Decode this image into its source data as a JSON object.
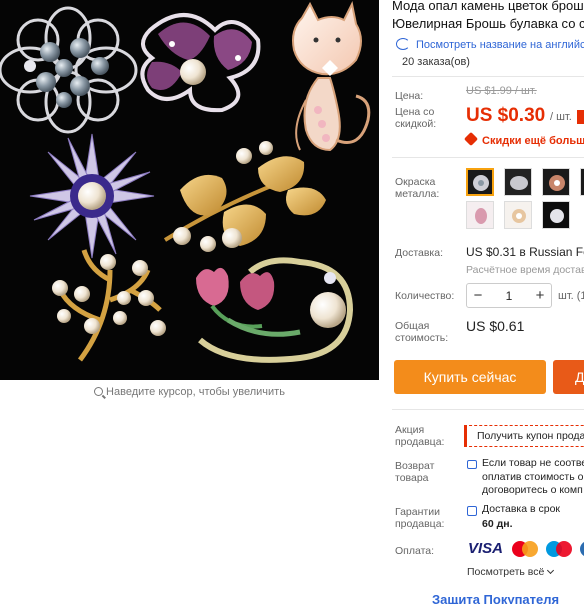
{
  "product": {
    "title_line1": "Мода опал камень цветок брош",
    "title_line2": "Ювелирная Брошь булавка со с",
    "translate_link": "Посмотреть название на английс",
    "orders": "20 заказа(ов)"
  },
  "image": {
    "zoom_hint": "Наведите курсор, чтобы увеличить"
  },
  "price": {
    "label": "Цена:",
    "old_value": "US $1.99 / шт.",
    "discount_label": "Цена со скидкой:",
    "value": "US $0.30",
    "per_unit": "/ шт.",
    "discount_note": "Скидки ещё больше е"
  },
  "color": {
    "label": "Окраска металла:",
    "swatches": [
      "swatch-1",
      "swatch-2",
      "swatch-3",
      "swatch-4",
      "swatch-5",
      "swatch-6",
      "swatch-7"
    ],
    "selected_index": 0
  },
  "shipping": {
    "label": "Доставка:",
    "value": "US $0.31 в Russian Fede",
    "estimate": "Расчётное время доставк"
  },
  "quantity": {
    "label": "Количество:",
    "minus": "−",
    "value": "1",
    "plus": "+",
    "unit": "шт. (1"
  },
  "total": {
    "label": "Общая стоимость:",
    "value": "US $0.61"
  },
  "actions": {
    "buy_now": "Купить сейчас",
    "add_to_cart": "Д"
  },
  "seller_promo": {
    "label": "Акция продавца:",
    "coupon": "Получить купон прода"
  },
  "returns": {
    "label": "Возврат товара",
    "line1": "Если товар не соотве",
    "line2": "оплатив стоимость о",
    "line3": "договоритесь о комп"
  },
  "guarantee": {
    "label": "Гарантии продавца:",
    "delivery": "Доставка в срок",
    "days": "60 дн."
  },
  "payment": {
    "label": "Оплата:",
    "visa": "VISA",
    "see_all": "Посмотреть всё"
  },
  "bottom": {
    "text": "Защита Покупателя"
  },
  "colors": {
    "accent_red": "#e62e04",
    "buy_orange": "#f38c1b",
    "cart_orange": "#e85a18",
    "link_blue": "#2f66d6"
  }
}
